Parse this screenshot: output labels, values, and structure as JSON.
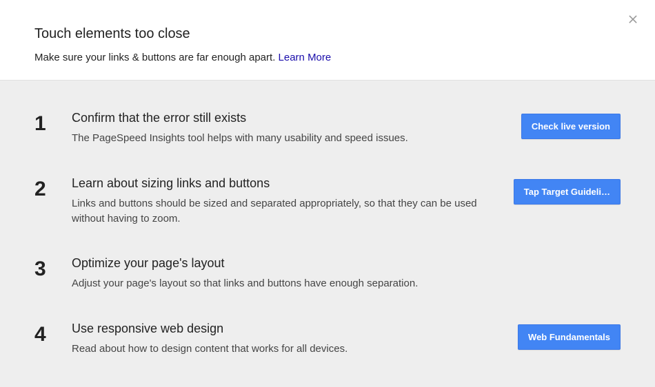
{
  "header": {
    "title": "Touch elements too close",
    "subtitle_prefix": "Make sure your links & buttons are far enough apart. ",
    "learn_more_label": "Learn More",
    "close_icon": "close-icon"
  },
  "steps": [
    {
      "number": "1",
      "title": "Confirm that the error still exists",
      "desc": "The PageSpeed Insights tool helps with many usability and speed issues.",
      "button": "Check live version"
    },
    {
      "number": "2",
      "title": "Learn about sizing links and buttons",
      "desc": "Links and buttons should be sized and separated appropriately, so that they can be used without having to zoom.",
      "button": "Tap Target Guideli…"
    },
    {
      "number": "3",
      "title": "Optimize your page's layout",
      "desc": "Adjust your page's layout so that links and buttons have enough separation.",
      "button": null
    },
    {
      "number": "4",
      "title": "Use responsive web design",
      "desc": "Read about how to design content that works for all devices.",
      "button": "Web Fundamentals"
    }
  ]
}
